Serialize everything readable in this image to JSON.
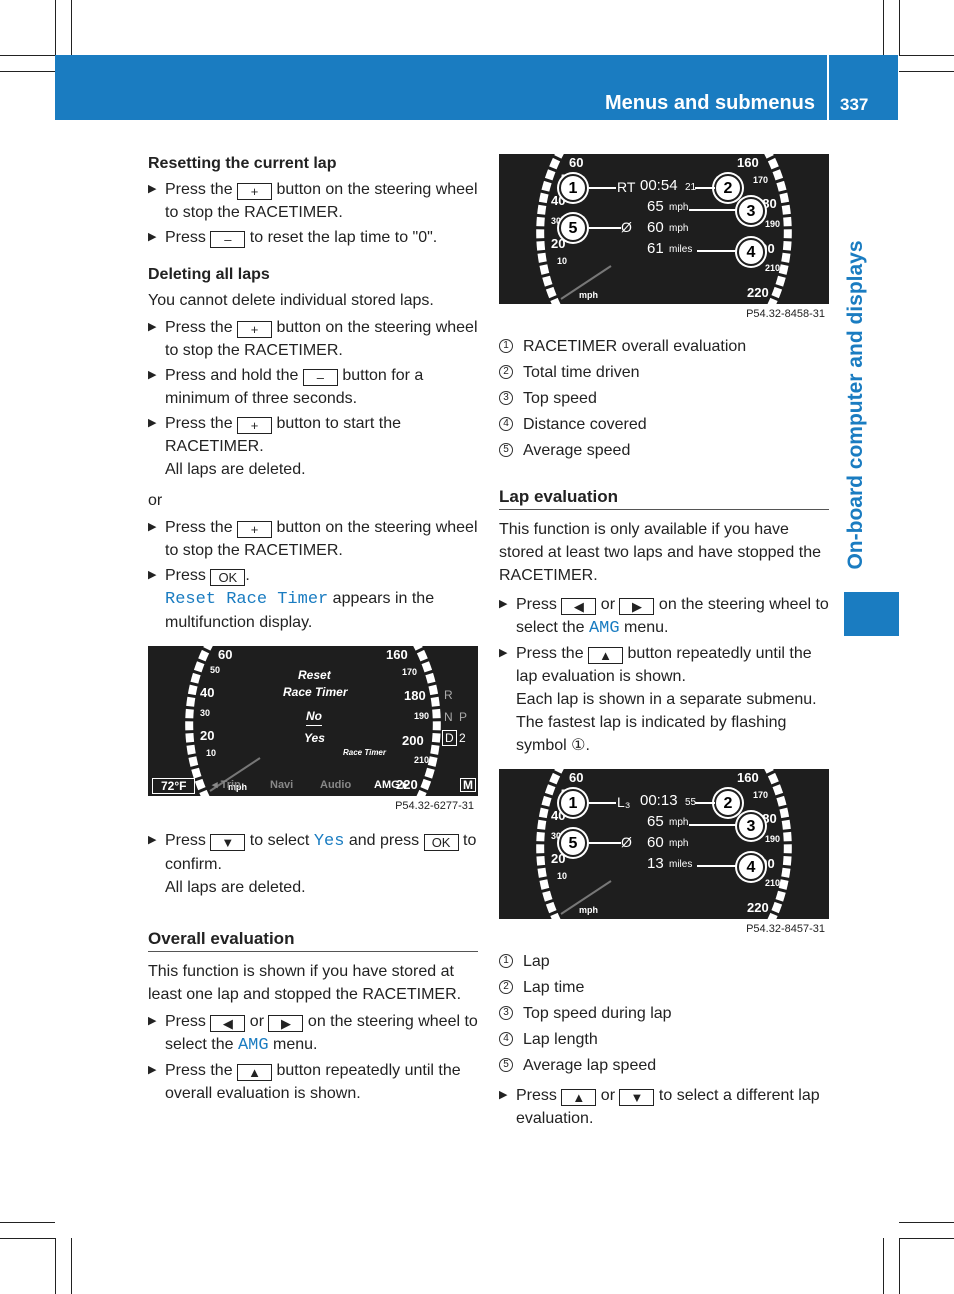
{
  "header": {
    "title": "Menus and submenus",
    "page": "337"
  },
  "side_tab": "On-board computer and displays",
  "colors": {
    "accent": "#1a7cc1",
    "display_bg": "#1e1e1e"
  },
  "left": [
    {
      "type": "h",
      "text": "Resetting the current lap"
    },
    {
      "type": "step",
      "parts": [
        {
          "t": "Press the "
        },
        {
          "k": "+"
        },
        {
          "t": " button on the steering wheel to stop the RACETIMER."
        }
      ]
    },
    {
      "type": "step",
      "parts": [
        {
          "t": "Press "
        },
        {
          "k": "–"
        },
        {
          "t": " to reset the lap time to \"0\"."
        }
      ]
    },
    {
      "type": "gap",
      "g": 12
    },
    {
      "type": "h",
      "text": "Deleting all laps"
    },
    {
      "type": "p",
      "text": "You cannot delete individual stored laps."
    },
    {
      "type": "step",
      "parts": [
        {
          "t": "Press the "
        },
        {
          "k": "+"
        },
        {
          "t": " button on the steering wheel to stop the RACETIMER."
        }
      ]
    },
    {
      "type": "step",
      "parts": [
        {
          "t": "Press and hold the "
        },
        {
          "k": "–"
        },
        {
          "t": " button for a minimum of three seconds."
        }
      ]
    },
    {
      "type": "step",
      "parts": [
        {
          "t": "Press the "
        },
        {
          "k": "+"
        },
        {
          "t": " button to start the RACETIMER."
        }
      ],
      "result": "All laps are deleted."
    },
    {
      "type": "gap",
      "g": 6
    },
    {
      "type": "p",
      "text": "or"
    },
    {
      "type": "step",
      "parts": [
        {
          "t": "Press the "
        },
        {
          "k": "+"
        },
        {
          "t": " button on the steering wheel to stop the RACETIMER."
        }
      ]
    },
    {
      "type": "step",
      "parts": [
        {
          "t": "Press "
        },
        {
          "k": "OK"
        },
        {
          "t": "."
        },
        {
          "br": true
        },
        {
          "m": "Reset Race Timer"
        },
        {
          "t": " appears in the multifunction display."
        }
      ]
    },
    {
      "type": "gap",
      "g": 10
    },
    {
      "type": "fig",
      "id": "reset",
      "caption": "P54.32-6277-31"
    },
    {
      "type": "gap",
      "g": 16
    },
    {
      "type": "step",
      "parts": [
        {
          "t": "Press "
        },
        {
          "k": "▼"
        },
        {
          "t": " to select "
        },
        {
          "m": "Yes"
        },
        {
          "t": " and press "
        },
        {
          "k": "OK"
        },
        {
          "t": " to confirm."
        }
      ],
      "result": "All laps are deleted."
    },
    {
      "type": "gap",
      "g": 26
    },
    {
      "type": "h2",
      "text": "Overall evaluation"
    },
    {
      "type": "p",
      "text": "This function is shown if you have stored at least one lap and stopped the RACETIMER."
    },
    {
      "type": "step",
      "parts": [
        {
          "t": "Press "
        },
        {
          "k": "◀"
        },
        {
          "t": " or "
        },
        {
          "k": "▶"
        },
        {
          "t": " on the steering wheel to select the "
        },
        {
          "m": "AMG"
        },
        {
          "t": " menu."
        }
      ]
    },
    {
      "type": "step",
      "parts": [
        {
          "t": "Press the "
        },
        {
          "k": "▲"
        },
        {
          "t": " button repeatedly until the overall evaluation is shown."
        }
      ]
    }
  ],
  "right": [
    {
      "type": "fig",
      "id": "overall",
      "caption": "P54.32-8458-31"
    },
    {
      "type": "gap",
      "g": 12
    },
    {
      "type": "legend",
      "items": [
        "RACETIMER overall evaluation",
        "Total time driven",
        "Top speed",
        "Distance covered",
        "Average speed"
      ]
    },
    {
      "type": "gap",
      "g": 22
    },
    {
      "type": "h2",
      "text": "Lap evaluation"
    },
    {
      "type": "p",
      "text": "This function is only available if you have stored at least two laps and have stopped the RACETIMER."
    },
    {
      "type": "gap",
      "g": 2
    },
    {
      "type": "step",
      "parts": [
        {
          "t": "Press "
        },
        {
          "k": "◀"
        },
        {
          "t": " or "
        },
        {
          "k": "▶"
        },
        {
          "t": " on the steering wheel to select the "
        },
        {
          "m": "AMG"
        },
        {
          "t": " menu."
        }
      ]
    },
    {
      "type": "step",
      "parts": [
        {
          "t": "Press the "
        },
        {
          "k": "▲"
        },
        {
          "t": " button repeatedly until the lap evaluation is shown."
        }
      ],
      "result": "Each lap is shown in a separate submenu. The fastest lap is indicated by flashing symbol ①."
    },
    {
      "type": "gap",
      "g": 10
    },
    {
      "type": "fig",
      "id": "lap",
      "caption": "P54.32-8457-31"
    },
    {
      "type": "gap",
      "g": 12
    },
    {
      "type": "legend",
      "items": [
        "Lap",
        "Lap time",
        "Top speed during lap",
        "Lap length",
        "Average lap speed"
      ]
    },
    {
      "type": "gap",
      "g": 6
    },
    {
      "type": "step",
      "parts": [
        {
          "t": "Press "
        },
        {
          "k": "▲"
        },
        {
          "t": " or "
        },
        {
          "k": "▼"
        },
        {
          "t": " to select a different lap evaluation."
        }
      ]
    }
  ],
  "gauge": {
    "left": [
      "60",
      "50",
      "40",
      "30",
      "20",
      "10",
      "mph"
    ],
    "right": [
      "160",
      "170",
      "180",
      "190",
      "200",
      "210",
      "220"
    ]
  },
  "figs": {
    "reset": {
      "lines": [
        "Reset",
        "Race Timer",
        "No",
        "Yes"
      ],
      "small": "Race Timer",
      "gears": [
        "R",
        "N",
        "P",
        "D",
        "2"
      ],
      "temp": "72°F",
      "menu": [
        "◂ Trip",
        "Navi",
        "Audio",
        "AMG ▸"
      ],
      "m": "M"
    },
    "overall": {
      "label": "RT",
      "time": "00:54",
      "frac": "21",
      "top": "65",
      "top_u": "mph",
      "avg_sym": "Ø",
      "avg": "60",
      "avg_u": "mph",
      "dist": "61",
      "dist_u": "miles"
    },
    "lap": {
      "label": "L₃",
      "time": "00:13",
      "frac": "55",
      "top": "65",
      "top_u": "mph",
      "avg_sym": "Ø",
      "avg": "60",
      "avg_u": "mph",
      "dist": "13",
      "dist_u": "miles"
    }
  }
}
